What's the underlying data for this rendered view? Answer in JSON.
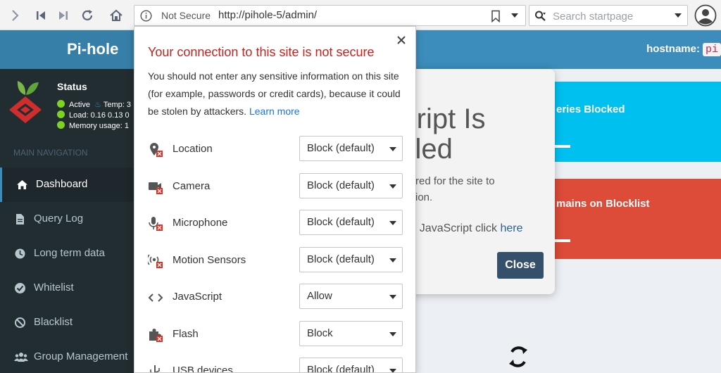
{
  "browser": {
    "security_label": "Not Secure",
    "url": "http://pihole-5/admin/",
    "search_placeholder": "Search startpage"
  },
  "header": {
    "logo_text": "Pi-hole",
    "hostname_label": "hostname:",
    "hostname_value": "pi"
  },
  "sidebar": {
    "status_title": "Status",
    "status_active": "Active",
    "status_temp": "Temp: 3",
    "status_load": "Load: 0.16 0.13 0",
    "status_memory": "Memory usage: 1",
    "nav_header": "MAIN NAVIGATION",
    "items": [
      {
        "label": "Dashboard",
        "icon": "home-icon"
      },
      {
        "label": "Query Log",
        "icon": "file-icon"
      },
      {
        "label": "Long term data",
        "icon": "history-icon"
      },
      {
        "label": "Whitelist",
        "icon": "check-circle-icon"
      },
      {
        "label": "Blacklist",
        "icon": "ban-icon"
      },
      {
        "label": "Group Management",
        "icon": "users-icon"
      }
    ]
  },
  "content": {
    "box_queries_blocked": "eries Blocked",
    "box_domains_blocklist": "mains on Blocklist",
    "box_value_dash": "--"
  },
  "js_modal": {
    "title_line1": "Script Is",
    "title_line2": "abled",
    "body_line1": "quired for the site to",
    "body_line2": "nction.",
    "enable_text": "ble JavaScript click",
    "enable_link": "here",
    "close_label": "Close"
  },
  "popup": {
    "title": "Your connection to this site is not secure",
    "description": "You should not enter any sensitive information on this site (for example, passwords or credit cards), because it could be stolen by attackers.",
    "learn_more": "Learn more",
    "permissions": [
      {
        "label": "Location",
        "value": "Block (default)",
        "icon": "location-blocked-icon"
      },
      {
        "label": "Camera",
        "value": "Block (default)",
        "icon": "camera-blocked-icon"
      },
      {
        "label": "Microphone",
        "value": "Block (default)",
        "icon": "microphone-blocked-icon"
      },
      {
        "label": "Motion Sensors",
        "value": "Block (default)",
        "icon": "motion-sensors-icon"
      },
      {
        "label": "JavaScript",
        "value": "Allow",
        "icon": "code-icon"
      },
      {
        "label": "Flash",
        "value": "Block",
        "icon": "puzzle-icon"
      },
      {
        "label": "USB devices",
        "value": "Block (default)",
        "icon": "usb-icon"
      }
    ]
  }
}
